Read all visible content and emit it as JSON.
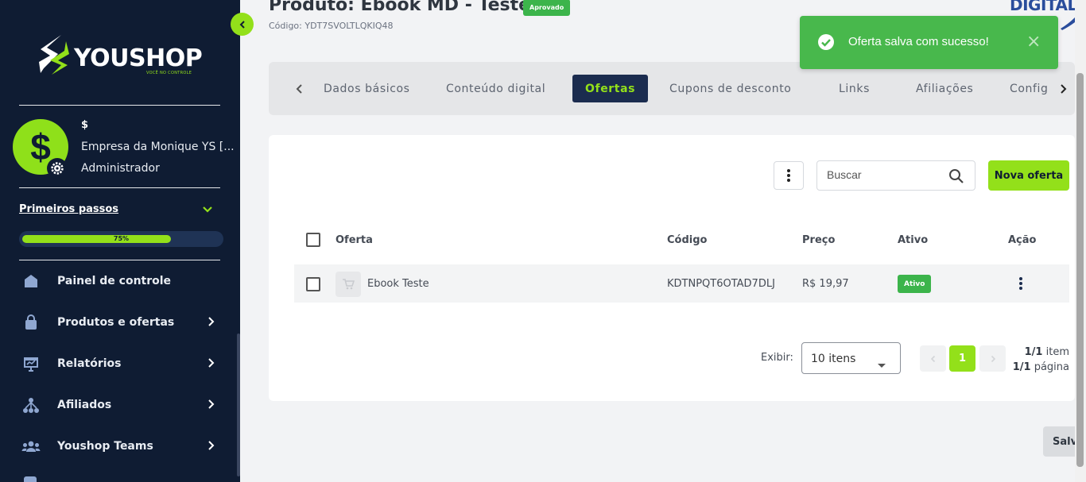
{
  "sidebar": {
    "brand": {
      "name": "YOUSHOP",
      "tagline": "VOCÊ NO CONTROLE"
    },
    "user": {
      "avatar_symbol": "$",
      "name": "$",
      "company": "Empresa da Monique YS [...",
      "role": "Administrador"
    },
    "first_steps": {
      "label": "Primeiros passos",
      "progress_label": "75%",
      "progress": 0.75
    },
    "items": [
      {
        "label": "Painel de controle",
        "icon": "home-icon",
        "has_chevron": false
      },
      {
        "label": "Produtos e ofertas",
        "icon": "bag-icon",
        "has_chevron": true
      },
      {
        "label": "Relatórios",
        "icon": "presentation-chart-icon",
        "has_chevron": true
      },
      {
        "label": "Afiliados",
        "icon": "network-icon",
        "has_chevron": true
      },
      {
        "label": "Youshop Teams",
        "icon": "users-icon",
        "has_chevron": true
      }
    ]
  },
  "header": {
    "title": "Produto: Ebook MD - Teste",
    "status_badge": "Aprovado",
    "code": "Código: YDT7SVOLTLQKIQ48",
    "partner_logo_text": "DIGITAL"
  },
  "tabs": {
    "items": [
      "Dados básicos",
      "Conteúdo digital",
      "Ofertas",
      "Cupons de desconto",
      "Links",
      "Afiliações",
      "Config"
    ],
    "active": "Ofertas"
  },
  "offers": {
    "search_placeholder": "Buscar",
    "new_offer_label": "Nova oferta",
    "columns": [
      "Oferta",
      "Código",
      "Preço",
      "Ativo",
      "Ação"
    ],
    "rows": [
      {
        "name": "Ebook Teste",
        "code": "KDTNPQT6OTAD7DLJ",
        "price": "R$ 19,97",
        "status": "Ativo"
      }
    ],
    "pagination": {
      "show_label": "Exibir:",
      "page_size": "10 itens",
      "current_page": "1",
      "items_count": "1/1",
      "items_label": "item",
      "pages_count": "1/1",
      "pages_label": "página"
    }
  },
  "save_label": "Salvar",
  "toast": {
    "message": "Oferta salva com sucesso!",
    "close": "×"
  },
  "colors": {
    "sidebar_bg": "#0f1c33",
    "accent": "#93e01a",
    "success": "#48b84c",
    "tab_active_bg": "#1b2c4f"
  }
}
